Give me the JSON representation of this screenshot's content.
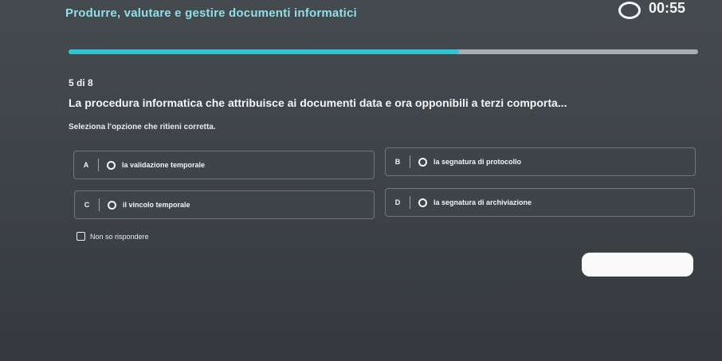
{
  "header": {
    "course_title": "Produrre, valutare e gestire documenti informatici",
    "timer": "00:55"
  },
  "progress": {
    "current": 5,
    "total": 8,
    "fraction": 0.62
  },
  "question": {
    "counter": "5 di 8",
    "text": "La procedura informatica che attribuisce ai documenti data e ora opponibili a terzi comporta...",
    "instruction": "Seleziona l'opzione che ritieni corretta."
  },
  "options": [
    {
      "letter": "A",
      "label": "la validazione temporale"
    },
    {
      "letter": "B",
      "label": "la segnatura di protocollo"
    },
    {
      "letter": "C",
      "label": "il vincolo temporale"
    },
    {
      "letter": "D",
      "label": "la segnatura di archiviazione"
    }
  ],
  "no_answer": {
    "label": "Non so rispondere"
  },
  "colors": {
    "accent": "#2fc4d3",
    "title": "#8fdfe6",
    "background": "#41464b"
  }
}
